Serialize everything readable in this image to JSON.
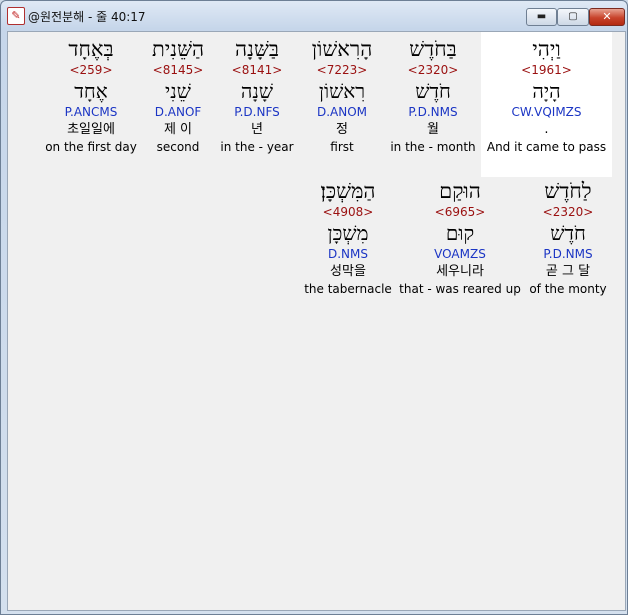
{
  "window": {
    "title": "@원전분해 - 줄 40:17",
    "min_label": "▬",
    "max_label": "▢",
    "close_label": "✕"
  },
  "rows": [
    {
      "words": [
        {
          "heb": "וַיְהִי",
          "strong": "<1961>",
          "lex": "הָיָה",
          "morph": "CW.VQIMZS",
          "kor": ".",
          "eng": "And it came to pass",
          "selected": true
        },
        {
          "heb": "בַּחֹדֶשׁ",
          "strong": "<2320>",
          "lex": "חֹדֶשׁ",
          "morph": "P.D.NMS",
          "kor": "월",
          "eng": "in the - month"
        },
        {
          "heb": "הָרִאשׁוֹן",
          "strong": "<7223>",
          "lex": "רִאשׁוֹן",
          "morph": "D.ANOM",
          "kor": "정",
          "eng": "first"
        },
        {
          "heb": "בַּשָּׁנָה",
          "strong": "<8141>",
          "lex": "שָׁנָה",
          "morph": "P.D.NFS",
          "kor": "년",
          "eng": "in the - year"
        },
        {
          "heb": "הַשֵּׁנִית",
          "strong": "<8145>",
          "lex": "שֵׁנִי",
          "morph": "D.ANOF",
          "kor": "제 이",
          "eng": "second"
        },
        {
          "heb": "בְּאֶחָד",
          "strong": "<259>",
          "lex": "אֶחָד",
          "morph": "P.ANCMS",
          "kor": "초일일에",
          "eng": "on the first day"
        }
      ]
    },
    {
      "words": [
        {
          "heb": "לַחֹדֶשׁ",
          "strong": "<2320>",
          "lex": "חֹדֶשׁ",
          "morph": "P.D.NMS",
          "kor": "곧 그 달",
          "eng": "of the monty"
        },
        {
          "heb": "הוּקַם",
          "strong": "<6965>",
          "lex": "קוּם",
          "morph": "VOAMZS",
          "kor": "세우니라",
          "eng": "that - was reared up"
        },
        {
          "heb": "הַמִּשְׁכָּן׃",
          "strong": "<4908>",
          "lex": "מִשְׁכָּן",
          "morph": "D.NMS",
          "kor": "성막을",
          "eng": "the tabernacle"
        }
      ]
    }
  ]
}
